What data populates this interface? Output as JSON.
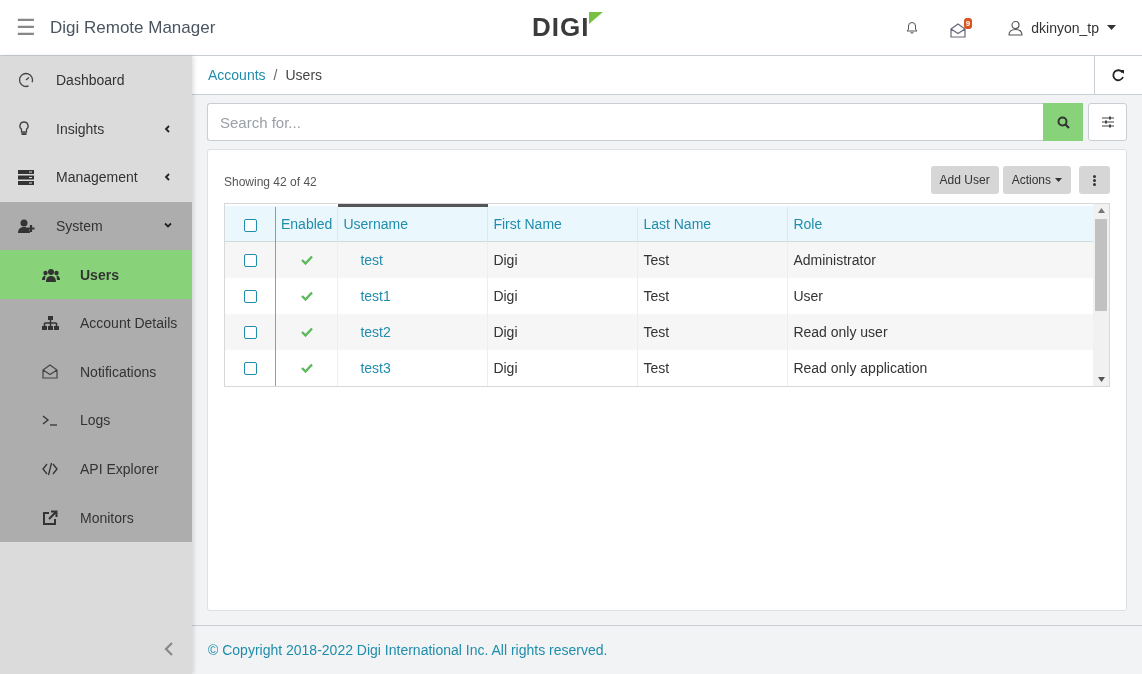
{
  "header": {
    "menu_icon": "☰",
    "app_title": "Digi Remote Manager",
    "logo": "DIGI",
    "mail_badge": "9",
    "username": "dkinyon_tp"
  },
  "sidebar": {
    "items": [
      {
        "label": "Dashboard",
        "selected": false
      },
      {
        "label": "Insights",
        "selected": false,
        "expanded": false
      },
      {
        "label": "Management",
        "selected": false,
        "expanded": false
      },
      {
        "label": "System",
        "selected": false,
        "expanded": true,
        "children": [
          {
            "label": "Users",
            "selected": true
          },
          {
            "label": "Account Details",
            "selected": false
          },
          {
            "label": "Notifications",
            "selected": false
          },
          {
            "label": "Logs",
            "selected": false
          },
          {
            "label": "API Explorer",
            "selected": false
          },
          {
            "label": "Monitors",
            "selected": false
          }
        ]
      }
    ]
  },
  "breadcrumb": {
    "items": [
      "Accounts",
      "Users"
    ],
    "separator": "/"
  },
  "search": {
    "placeholder": "Search for..."
  },
  "table_toolbar": {
    "count": "Showing 42 of 42",
    "buttons": [
      "Add User",
      "Actions"
    ]
  },
  "table": {
    "all_checked": false,
    "columns": [
      {
        "label": "Enabled",
        "sorted": false
      },
      {
        "label": "Username",
        "sorted": true
      },
      {
        "label": "First Name",
        "sorted": false
      },
      {
        "label": "Last Name",
        "sorted": false
      },
      {
        "label": "Role",
        "sorted": false
      }
    ],
    "rows": [
      {
        "checked": false,
        "enabled": true,
        "username": "test",
        "first_name": "Digi",
        "last_name": "Test",
        "role": "Administrator"
      },
      {
        "checked": false,
        "enabled": true,
        "username": "test1",
        "first_name": "Digi",
        "last_name": "Test",
        "role": "User"
      },
      {
        "checked": false,
        "enabled": true,
        "username": "test2",
        "first_name": "Digi",
        "last_name": "Test",
        "role": "Read only user"
      },
      {
        "checked": false,
        "enabled": true,
        "username": "test3",
        "first_name": "Digi",
        "last_name": "Test",
        "role": "Read only application"
      }
    ]
  },
  "footer": {
    "copyright": "© Copyright 2018-2022 Digi International Inc. All rights reserved."
  }
}
